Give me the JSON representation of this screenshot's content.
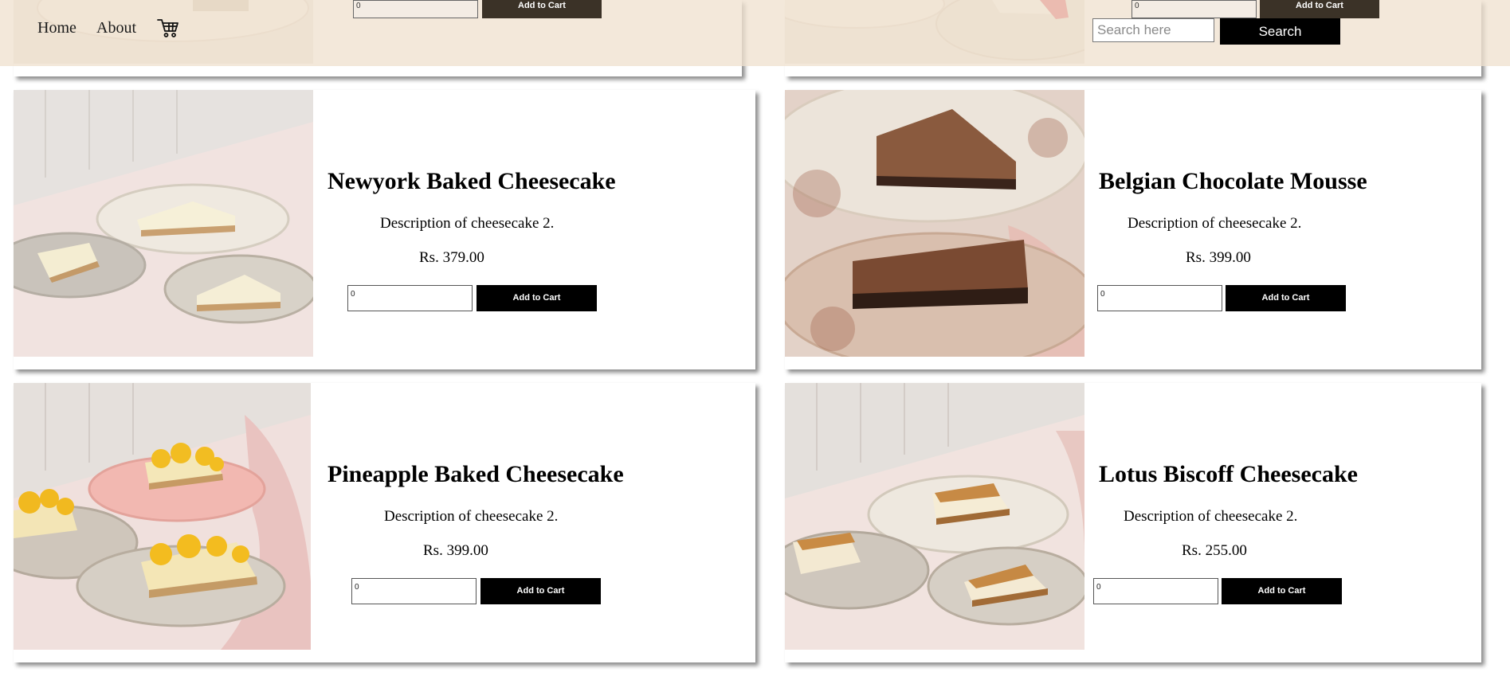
{
  "navbar": {
    "home_label": "Home",
    "about_label": "About",
    "cart_icon": "shopping-cart-icon",
    "search_placeholder": "Search here",
    "search_button_label": "Search",
    "background_color": "#F0E2CF"
  },
  "partial_row": [
    {
      "qty_value": "0",
      "add_label": "Add to Cart"
    },
    {
      "qty_value": "0",
      "add_label": "Add to Cart"
    }
  ],
  "products": [
    {
      "name": "Newyork Baked Cheesecake",
      "description": "Description of cheesecake 2.",
      "price": "Rs. 379.00",
      "qty_value": "0",
      "add_label": "Add to Cart"
    },
    {
      "name": "Belgian Chocolate Mousse",
      "description": "Description of cheesecake 2.",
      "price": "Rs. 399.00",
      "qty_value": "0",
      "add_label": "Add to Cart"
    },
    {
      "name": "Pineapple Baked Cheesecake",
      "description": "Description of cheesecake 2.",
      "price": "Rs. 399.00",
      "qty_value": "0",
      "add_label": "Add to Cart"
    },
    {
      "name": "Lotus Biscoff Cheesecake",
      "description": "Description of cheesecake 2.",
      "price": "Rs. 255.00",
      "qty_value": "0",
      "add_label": "Add to Cart"
    }
  ],
  "colors": {
    "button_bg": "#000000",
    "button_text": "#FFFFFF",
    "top_button_bg": "#3B3227"
  }
}
